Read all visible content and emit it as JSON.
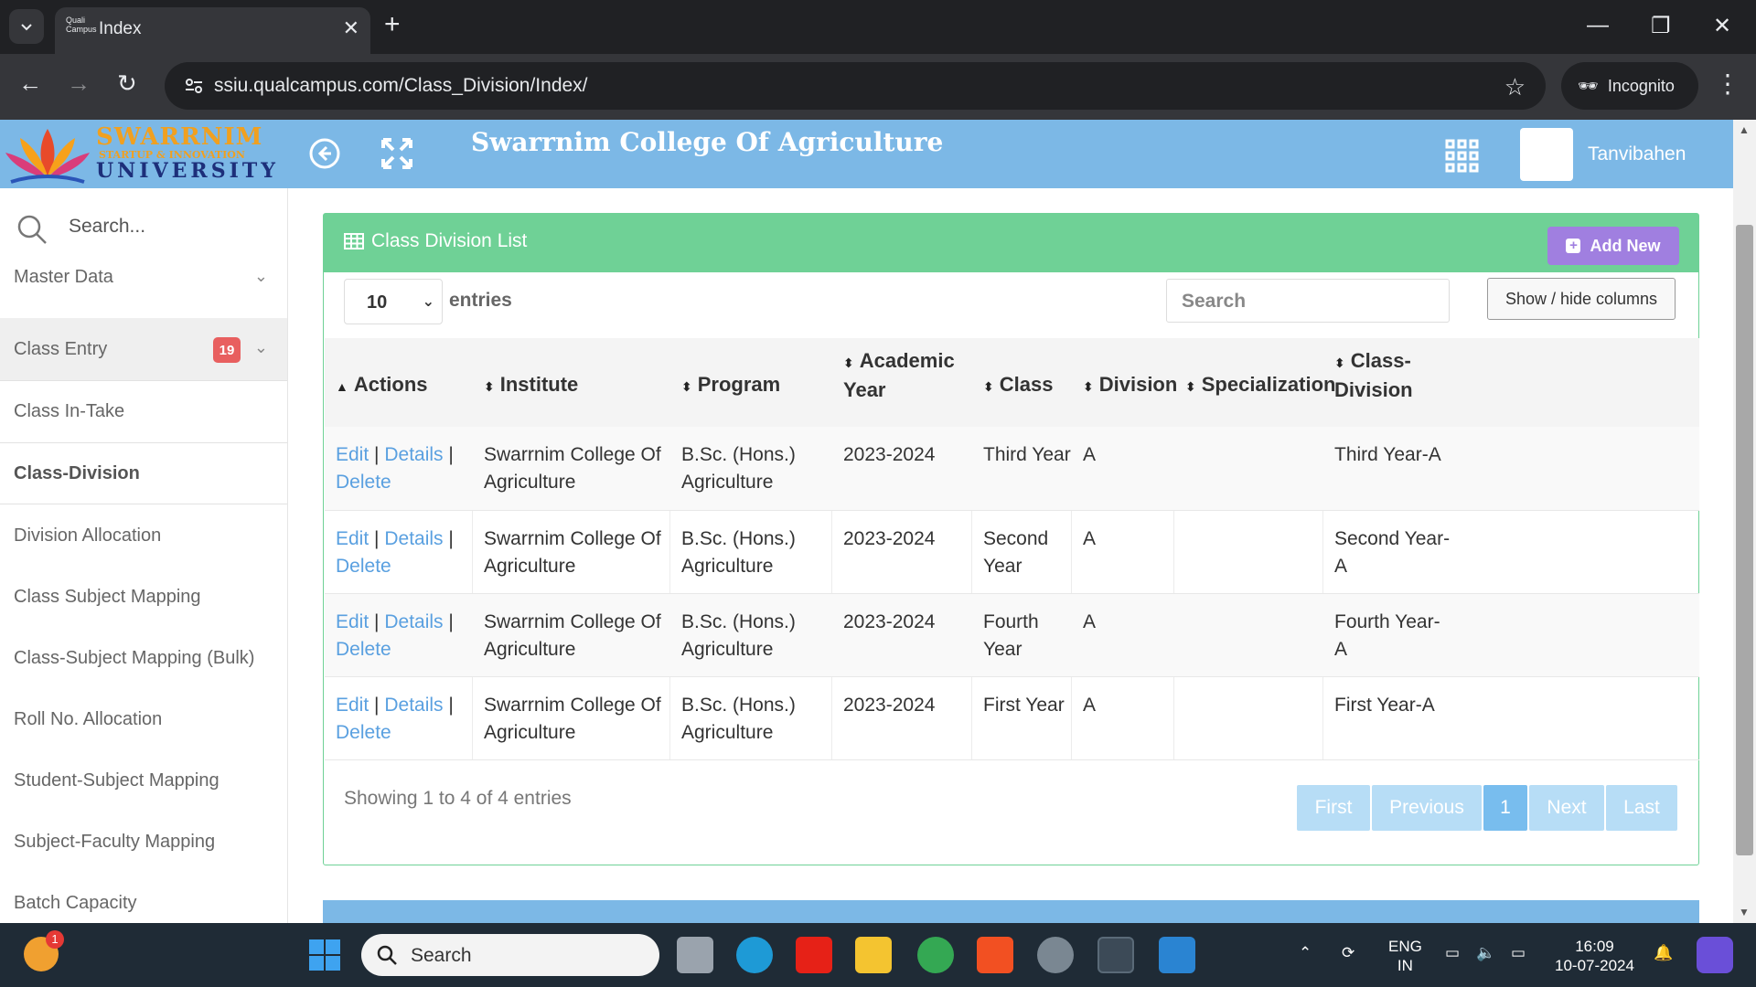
{
  "browser": {
    "tab_title": "Index",
    "favicon_text": "Quali Campus",
    "url": "ssiu.qualcampus.com/Class_Division/Index/",
    "incognito_label": "Incognito"
  },
  "header": {
    "logo_line1": "SWARRNIM",
    "logo_line2": "STARTUP & INNOVATION",
    "logo_line3": "UNIVERSITY",
    "college_name": "Swarrnim College Of Agriculture",
    "user_name": "Tanvibahen"
  },
  "sidebar": {
    "search_placeholder": "Search...",
    "items": [
      {
        "label": "Master Data"
      },
      {
        "label": "Class Entry",
        "badge": "19"
      },
      {
        "label": "Class In-Take"
      },
      {
        "label": "Class-Division"
      },
      {
        "label": "Division Allocation"
      },
      {
        "label": "Class Subject Mapping"
      },
      {
        "label": "Class-Subject Mapping (Bulk)"
      },
      {
        "label": "Roll No. Allocation"
      },
      {
        "label": "Student-Subject Mapping"
      },
      {
        "label": "Subject-Faculty Mapping"
      },
      {
        "label": "Batch Capacity"
      }
    ]
  },
  "card": {
    "title": "Class Division List",
    "add_new_label": "Add New",
    "page_length": "10",
    "entries_label": "entries",
    "search_placeholder": "Search",
    "colvis_label": "Show / hide columns",
    "columns": [
      "Actions",
      "Institute",
      "Program",
      "Academic",
      "Year",
      "Class",
      "Division",
      "Specialization",
      "Class-",
      "Division"
    ],
    "action_labels": {
      "edit": "Edit",
      "details": "Details",
      "delete": "Delete",
      "sep": "|"
    },
    "rows": [
      {
        "institute_1": "Swarrnim College Of",
        "institute_2": "Agriculture",
        "program_1": "B.Sc. (Hons.)",
        "program_2": "Agriculture",
        "year": "2023-2024",
        "class_1": "Third Year",
        "class_2": "",
        "division": "A",
        "specialization": "",
        "cd_1": "Third Year-A",
        "cd_2": ""
      },
      {
        "institute_1": "Swarrnim College Of",
        "institute_2": "Agriculture",
        "program_1": "B.Sc. (Hons.)",
        "program_2": "Agriculture",
        "year": "2023-2024",
        "class_1": "Second",
        "class_2": "Year",
        "division": "A",
        "specialization": "",
        "cd_1": "Second Year-",
        "cd_2": "A"
      },
      {
        "institute_1": "Swarrnim College Of",
        "institute_2": "Agriculture",
        "program_1": "B.Sc. (Hons.)",
        "program_2": "Agriculture",
        "year": "2023-2024",
        "class_1": "Fourth",
        "class_2": "Year",
        "division": "A",
        "specialization": "",
        "cd_1": "Fourth Year-",
        "cd_2": "A"
      },
      {
        "institute_1": "Swarrnim College Of",
        "institute_2": "Agriculture",
        "program_1": "B.Sc. (Hons.)",
        "program_2": "Agriculture",
        "year": "2023-2024",
        "class_1": "First Year",
        "class_2": "",
        "division": "A",
        "specialization": "",
        "cd_1": "First Year-A",
        "cd_2": ""
      }
    ],
    "info": "Showing 1 to 4 of 4 entries",
    "pager": {
      "first": "First",
      "previous": "Previous",
      "page": "1",
      "next": "Next",
      "last": "Last"
    }
  },
  "taskbar": {
    "search_label": "Search",
    "lang_line1": "ENG",
    "lang_line2": "IN",
    "time": "16:09",
    "date": "10-07-2024",
    "notification_count": "1"
  },
  "colors": {
    "header_blue": "#7cb8e6",
    "card_green": "#6fd196",
    "add_purple": "#a07fe0",
    "link_blue": "#5aa0e0",
    "badge_red": "#e85f5f"
  }
}
